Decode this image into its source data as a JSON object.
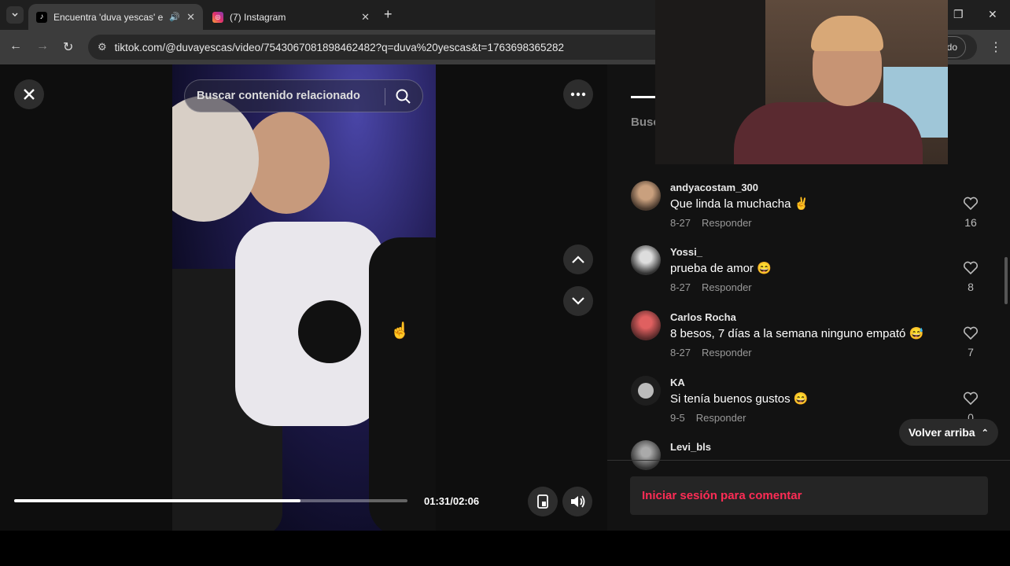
{
  "browser": {
    "tabs": [
      {
        "title": "Encuentra 'duva yescas' en",
        "active": true,
        "favicon": "tiktok-icon"
      },
      {
        "title": "(7) Instagram",
        "active": false,
        "favicon": "instagram-icon"
      }
    ],
    "url": "tiktok.com/@duvayescas/video/7543067081898462482?q=duva%20yescas&t=1763698365282",
    "profile_chip": "itado"
  },
  "video": {
    "search_placeholder": "Buscar contenido relacionado",
    "progress": 0.728,
    "time": "01:31/02:06"
  },
  "panel": {
    "search_partial": "Busc",
    "comments": [
      {
        "user": "andyacostam_300",
        "text": "Que linda la muchacha ✌",
        "date": "8-27",
        "reply": "Responder",
        "likes": "16"
      },
      {
        "user": "Yossi_",
        "text": "prueba de amor 😄",
        "date": "8-27",
        "reply": "Responder",
        "likes": "8"
      },
      {
        "user": "Carlos Rocha",
        "text": "8 besos, 7 días a la semana ninguno empató 😅",
        "date": "8-27",
        "reply": "Responder",
        "likes": "7"
      },
      {
        "user": "KA",
        "text": "Si tenía buenos gustos 😄",
        "date": "9-5",
        "reply": "Responder",
        "likes": "0"
      },
      {
        "user": "Levi_bls",
        "text": "",
        "date": "",
        "reply": "",
        "likes": ""
      }
    ],
    "back_to_top": "Volver arriba",
    "login_prompt": "Iniciar sesión para comentar"
  },
  "colors": {
    "accent": "#fe2c55",
    "panel_bg": "#121212",
    "chrome_bg": "#3c3c3c"
  }
}
